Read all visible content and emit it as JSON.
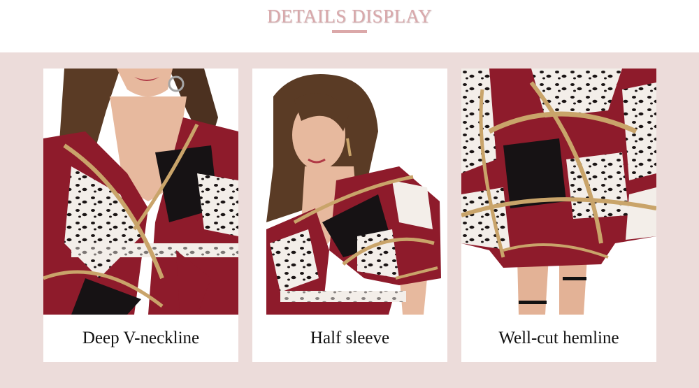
{
  "header": {
    "title": "DETAILS DISPLAY"
  },
  "cards": [
    {
      "caption": "Deep V-neckline",
      "image": "dress-neckline-closeup"
    },
    {
      "caption": "Half sleeve",
      "image": "model-half-sleeve"
    },
    {
      "caption": "Well-cut hemline",
      "image": "dress-hemline-closeup"
    }
  ],
  "colors": {
    "title": "#d9a8ab",
    "underline": "#dba8a9",
    "band": "#ecdcda",
    "dress_red": "#8e1b2b",
    "dress_black": "#161214",
    "dress_gold": "#c9a46a",
    "skin": "#e7b99e",
    "hair": "#5a3b25"
  }
}
